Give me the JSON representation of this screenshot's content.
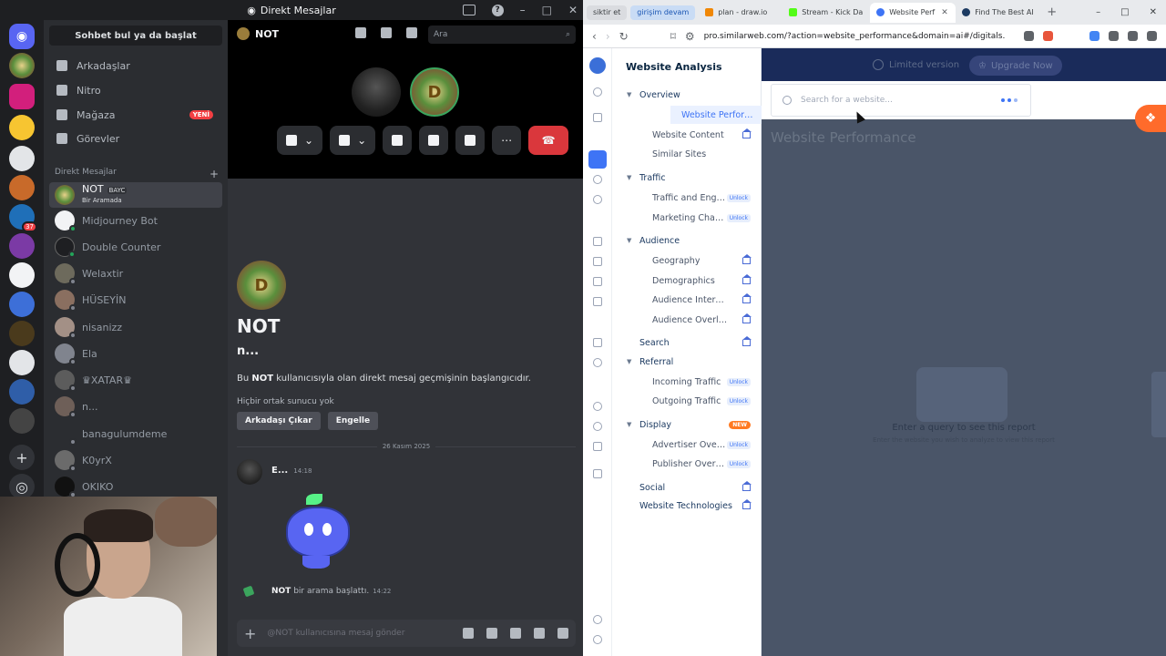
{
  "discord": {
    "window_title": "Direkt Mesajlar",
    "search_button": "Sohbet bul ya da başlat",
    "nav": [
      {
        "label": "Arkadaşlar",
        "icon": "friends-icon"
      },
      {
        "label": "Nitro",
        "icon": "nitro-icon"
      },
      {
        "label": "Mağaza",
        "icon": "shop-icon",
        "badge": "YENİ"
      },
      {
        "label": "Görevler",
        "icon": "quests-icon"
      }
    ],
    "dm_header": "Direkt Mesajlar",
    "dm_add": "+",
    "active_dm": {
      "name": "NOT",
      "tag": "BAYC",
      "sub": "Bir Aramada"
    },
    "dms": [
      "Midjourney Bot",
      "Double Counter",
      "Welaxtir",
      "HÜSEYİN",
      "nisanizz",
      "Ela",
      "♛XATAR♛",
      "n...",
      "banagulumdeme",
      "K0yrX",
      "OKIKO"
    ],
    "guild_badge": "37",
    "chat": {
      "header_name": "NOT",
      "search_placeholder": "Ara",
      "profile_name": "NOT",
      "profile_sub": "n...",
      "intro_prefix": "Bu ",
      "intro_name": "NOT",
      "intro_suffix": " kullanıcısıyla olan direkt mesaj geçmişinin başlangıcıdır.",
      "no_common_server": "Hiçbir ortak sunucu yok",
      "remove_friend": "Arkadaşı Çıkar",
      "block": "Engelle",
      "date_divider": "26 Kasım 2025",
      "msg_author": "E...",
      "msg_time": "14:18",
      "call_user": "NOT",
      "call_text": " bir arama başlattı.",
      "call_time": "14:22",
      "composer_placeholder": "@NOT kullanıcısına mesaj gönder"
    }
  },
  "browser": {
    "tabs": [
      {
        "label": "siktir et",
        "kind": "pill"
      },
      {
        "label": "girişim devam",
        "kind": "pill-blue"
      },
      {
        "label": "plan - draw.io",
        "color": "#f08705"
      },
      {
        "label": "Stream - Kick Da",
        "color": "#53fc18"
      },
      {
        "label": "Website Perf",
        "color": "#3e74f5",
        "active": true
      },
      {
        "label": "Find The Best AI",
        "color": "#1c3a61"
      }
    ],
    "url": "pro.similarweb.com/?action=website_performance&domain=ai#/digitals...",
    "sidebar_title": "Website Analysis",
    "nav": {
      "overview": "Overview",
      "website_performance": "Website Performance",
      "website_content": "Website Content",
      "similar_sites": "Similar Sites",
      "traffic": "Traffic",
      "traffic_engagement": "Traffic and Engag...",
      "marketing_channels": "Marketing Channe...",
      "audience": "Audience",
      "geography": "Geography",
      "demographics": "Demographics",
      "audience_interests": "Audience Interests",
      "audience_overlap": "Audience Overlap",
      "search": "Search",
      "referral": "Referral",
      "incoming_traffic": "Incoming Traffic",
      "outgoing_traffic": "Outgoing Traffic",
      "display": "Display",
      "advertiser_overview": "Advertiser Overvi...",
      "publisher_overview": "Publisher Overview",
      "social": "Social",
      "website_technologies": "Website Technologies",
      "unlock": "Unlock",
      "new": "NEW"
    },
    "limited_version": "Limited version",
    "upgrade_now": "Upgrade Now",
    "search_placeholder": "Search for a website...",
    "page_title": "Website Performance",
    "empty_title": "Enter a query to see this report",
    "empty_sub": "Enter the website you wish to analyze to view this report"
  }
}
